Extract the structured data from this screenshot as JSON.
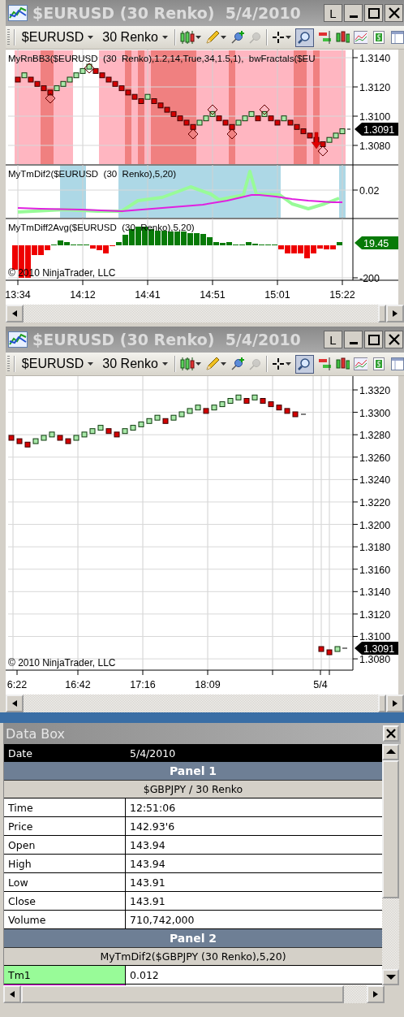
{
  "windows": [
    {
      "title": "$EURUSD (30 Renko)  5/4/2010",
      "link_button": "L",
      "instrument": "$EURUSD",
      "period": "30 Renko",
      "zoom_mode": true,
      "pin_remove_disabled": true,
      "panels": [
        {
          "kind": "price-bands",
          "label": "MyRnBB3($EURUSD  (30  Renko),1.2,14,True,34,1.5,1),  bwFractals($EU",
          "yticks": [
            "1.3140",
            "1.3120",
            "1.3100",
            "1.3080"
          ],
          "marker": "1.3091"
        },
        {
          "kind": "lines",
          "label": "MyTmDif2($EURUSD  (30  Renko),5,20)",
          "yticks": [
            "0.02"
          ]
        },
        {
          "kind": "histogram",
          "label": "MyTmDiff2Avg($EURUSD  (30  Renko),5,20)",
          "yticks": [
            "-200"
          ],
          "marker": "19.45",
          "copyright": "© 2010 NinjaTrader, LLC"
        }
      ],
      "xticks": [
        "13:34",
        "14:12",
        "14:41",
        "14:51",
        "15:01",
        "15:22"
      ]
    },
    {
      "title": "$EURUSD (30 Renko)  5/4/2010",
      "link_button": "L",
      "instrument": "$EURUSD",
      "period": "30 Renko",
      "zoom_mode": true,
      "pin_remove_disabled": true,
      "panels": [
        {
          "kind": "price",
          "yticks": [
            "1.3320",
            "1.3300",
            "1.3280",
            "1.3260",
            "1.3240",
            "1.3220",
            "1.3200",
            "1.3180",
            "1.3160",
            "1.3140",
            "1.3120",
            "1.3100",
            "1.3080"
          ],
          "marker": "1.3091",
          "copyright": "© 2010 NinjaTrader, LLC"
        }
      ],
      "xticks": [
        "6:22",
        "16:42",
        "17:16",
        "18:09",
        "5/4"
      ]
    }
  ],
  "data_box": {
    "title": "Data Box",
    "header": {
      "label": "Date",
      "value": "5/4/2010"
    },
    "sections": [
      {
        "title": "Panel 1",
        "subtitle": "$GBPJPY / 30 Renko",
        "rows": [
          {
            "label": "Time",
            "value": "12:51:06"
          },
          {
            "label": "Price",
            "value": "142.93'6"
          },
          {
            "label": "Open",
            "value": "143.94"
          },
          {
            "label": "High",
            "value": "143.94"
          },
          {
            "label": "Low",
            "value": "143.91"
          },
          {
            "label": "Close",
            "value": "143.91"
          },
          {
            "label": "Volume",
            "value": "710,742,000"
          }
        ]
      },
      {
        "title": "Panel 2",
        "subtitle": "MyTmDif2($GBPJPY (30 Renko),5,20)",
        "rows": [
          {
            "label": "Tm1",
            "value": "0.012",
            "color": "#98fb98"
          },
          {
            "color": "#ff00ff"
          }
        ]
      }
    ]
  }
}
